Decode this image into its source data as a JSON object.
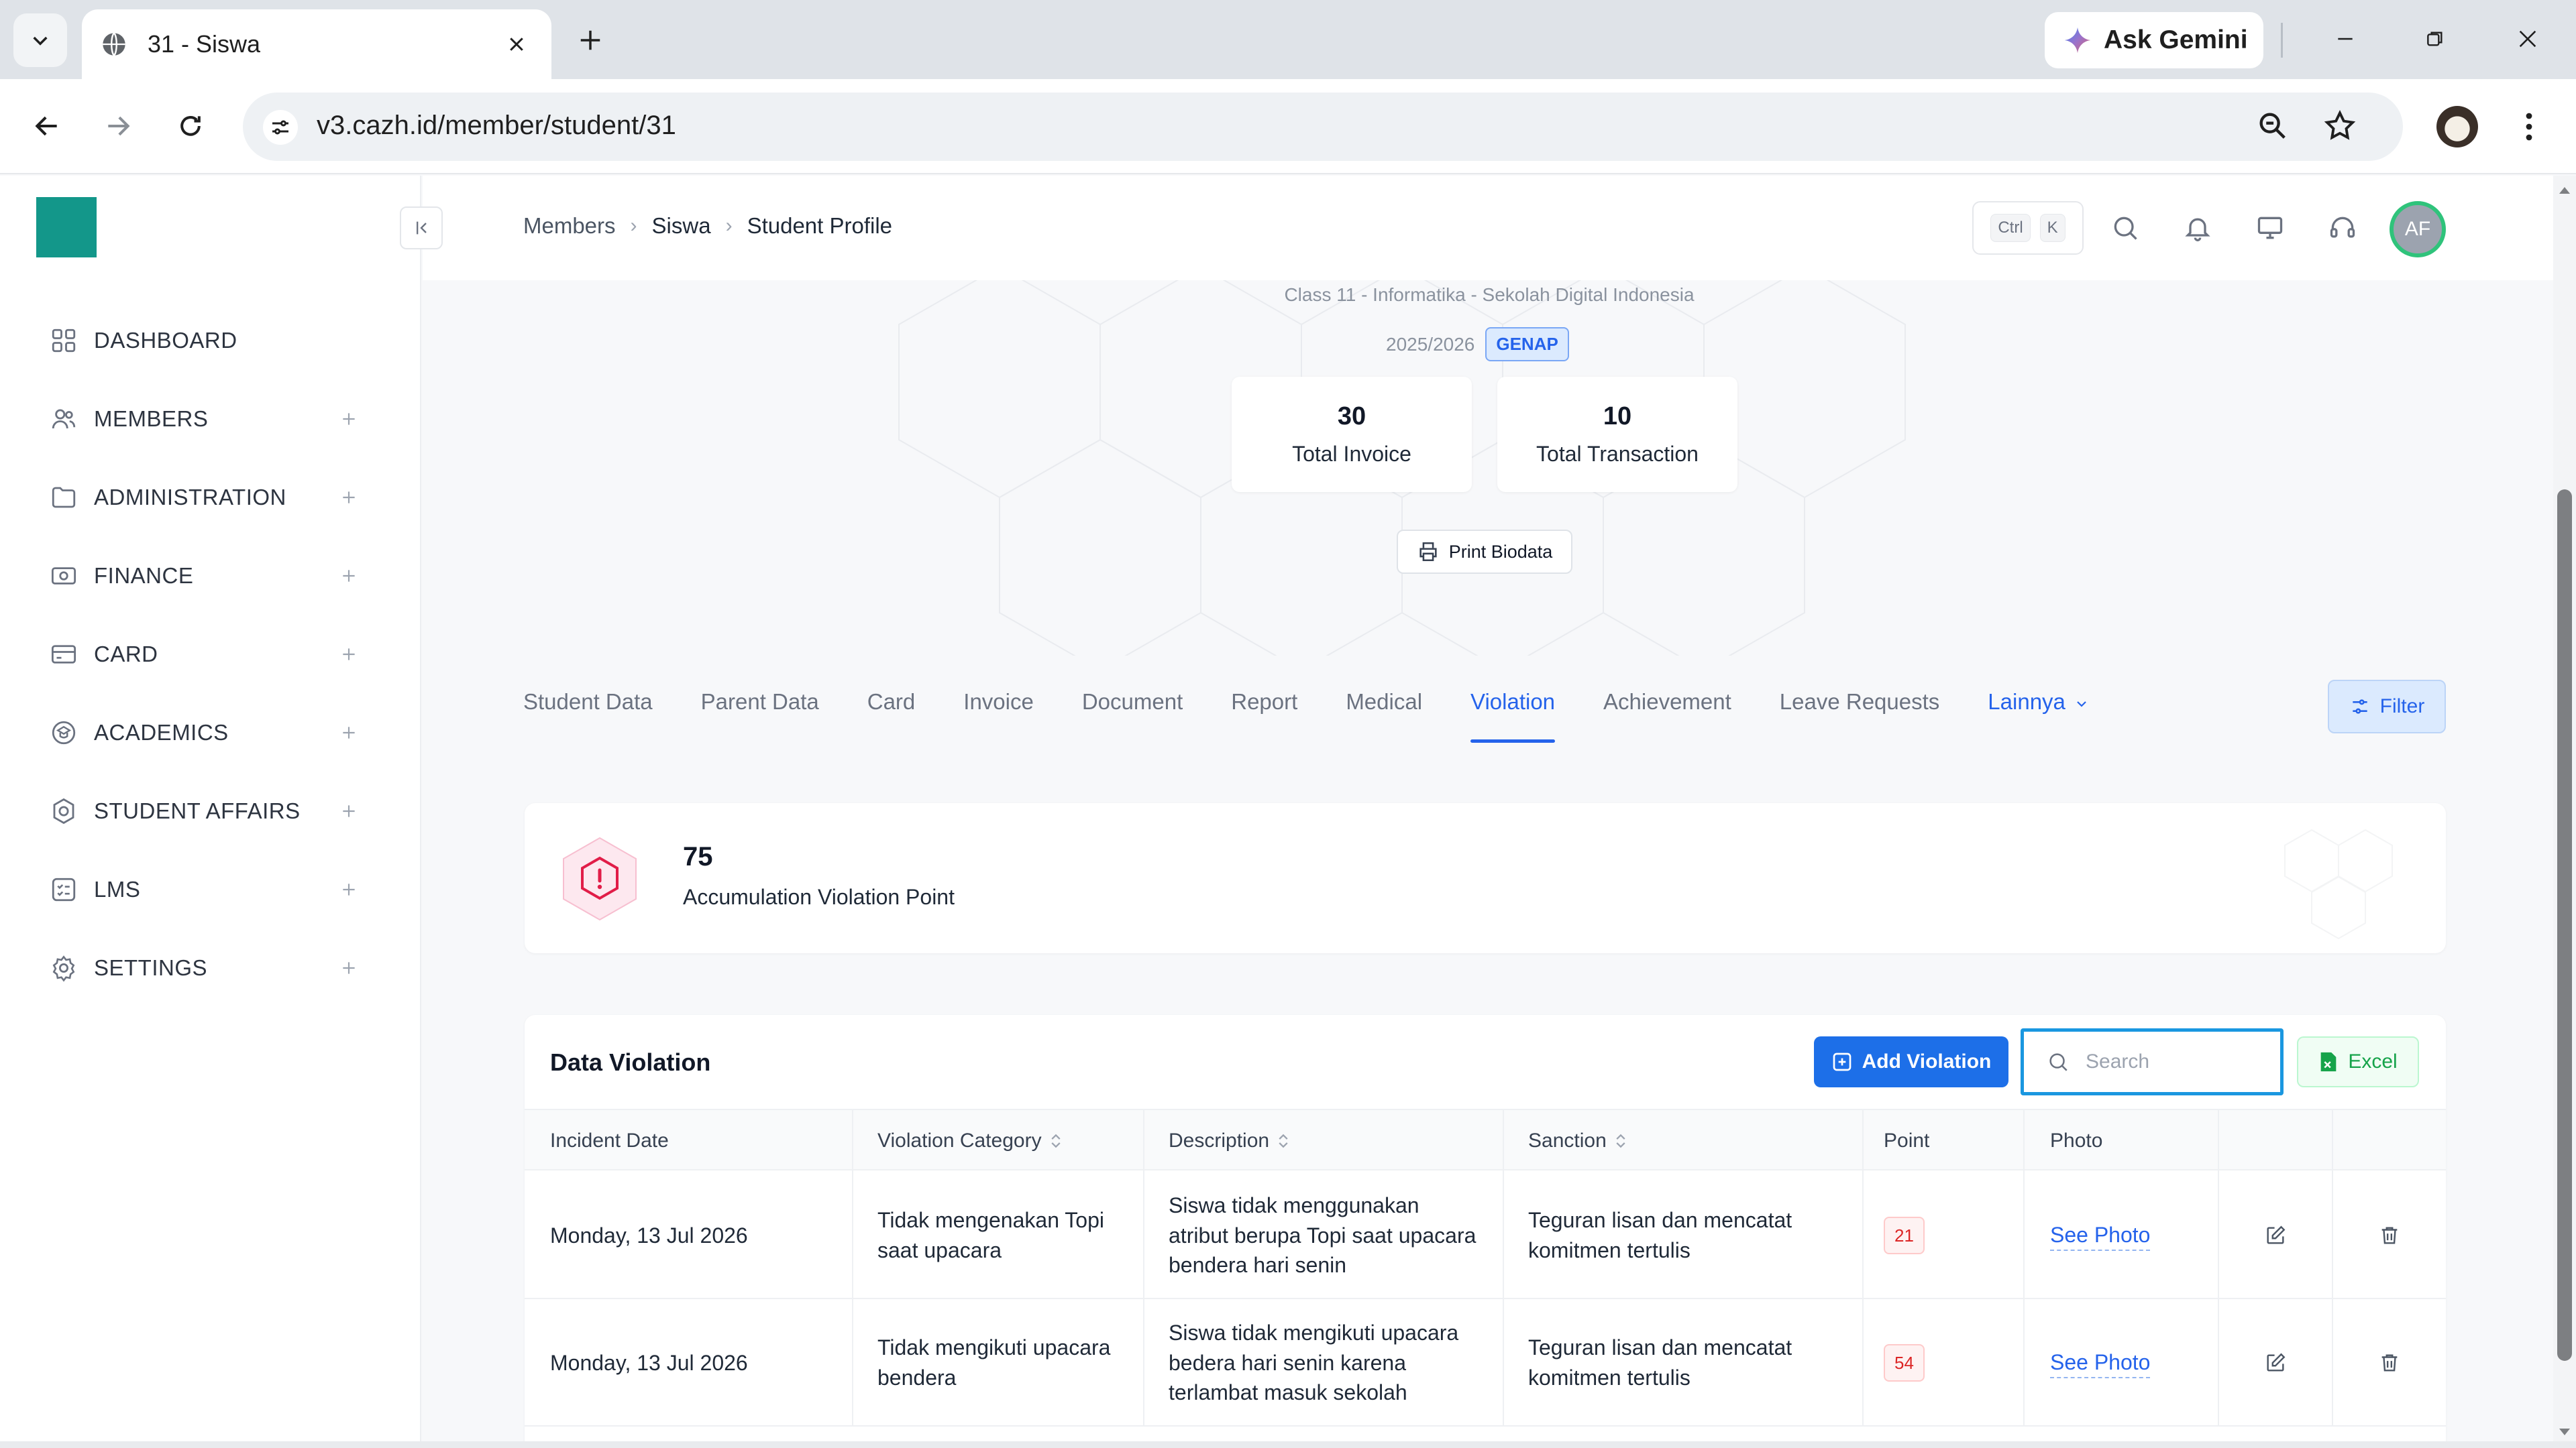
{
  "browser": {
    "tab_title": "31 - Siswa",
    "url": "v3.cazh.id/member/student/31",
    "gemini_label": "Ask Gemini"
  },
  "sidebar": {
    "items": [
      {
        "label": "DASHBOARD",
        "icon": "dashboard-grid-icon",
        "expandable": false
      },
      {
        "label": "MEMBERS",
        "icon": "users-icon",
        "expandable": true
      },
      {
        "label": "ADMINISTRATION",
        "icon": "folder-icon",
        "expandable": true
      },
      {
        "label": "FINANCE",
        "icon": "money-icon",
        "expandable": true
      },
      {
        "label": "CARD",
        "icon": "card-icon",
        "expandable": true
      },
      {
        "label": "ACADEMICS",
        "icon": "academics-icon",
        "expandable": true
      },
      {
        "label": "STUDENT AFFAIRS",
        "icon": "student-affairs-icon",
        "expandable": true
      },
      {
        "label": "LMS",
        "icon": "lms-icon",
        "expandable": true
      },
      {
        "label": "SETTINGS",
        "icon": "gear-icon",
        "expandable": true
      }
    ]
  },
  "header": {
    "breadcrumb": [
      "Members",
      "Siswa",
      "Student Profile"
    ],
    "shortcut_keys": [
      "Ctrl",
      "K"
    ],
    "avatar_initials": "AF"
  },
  "profile": {
    "class_line": "Class 11 - Informatika - Sekolah Digital Indonesia",
    "year": "2025/2026",
    "semester": "GENAP",
    "stats": [
      {
        "value": "30",
        "label": "Total Invoice"
      },
      {
        "value": "10",
        "label": "Total Transaction"
      }
    ],
    "print_label": "Print Biodata"
  },
  "tabs": {
    "items": [
      "Student Data",
      "Parent Data",
      "Card",
      "Invoice",
      "Document",
      "Report",
      "Medical",
      "Violation",
      "Achievement",
      "Leave Requests"
    ],
    "active": "Violation",
    "more_label": "Lainnya",
    "filter_label": "Filter"
  },
  "accumulation": {
    "value": "75",
    "label": "Accumulation Violation Point"
  },
  "violations": {
    "title": "Data Violation",
    "add_label": "Add Violation",
    "search_placeholder": "Search",
    "excel_label": "Excel",
    "columns": [
      "Incident Date",
      "Violation Category",
      "Description",
      "Sanction",
      "Point",
      "Photo"
    ],
    "rows": [
      {
        "date": "Monday, 13 Jul 2026",
        "category": "Tidak mengenakan Topi saat upacara",
        "description": "Siswa tidak menggunakan atribut berupa Topi saat upacara bendera hari senin",
        "sanction": "Teguran lisan dan mencatat komitmen tertulis",
        "point": "21",
        "photo_label": "See Photo"
      },
      {
        "date": "Monday, 13 Jul 2026",
        "category": "Tidak mengikuti upacara bendera",
        "description": "Siswa tidak mengikuti upacara bedera hari senin karena terlambat masuk sekolah",
        "sanction": "Teguran lisan dan mencatat komitmen tertulis",
        "point": "54",
        "photo_label": "See Photo"
      }
    ]
  },
  "colors": {
    "brand": "#13978a",
    "primary": "#2563eb",
    "danger": "#dc2626",
    "success": "#16a34a",
    "focus": "#1a97e0"
  }
}
